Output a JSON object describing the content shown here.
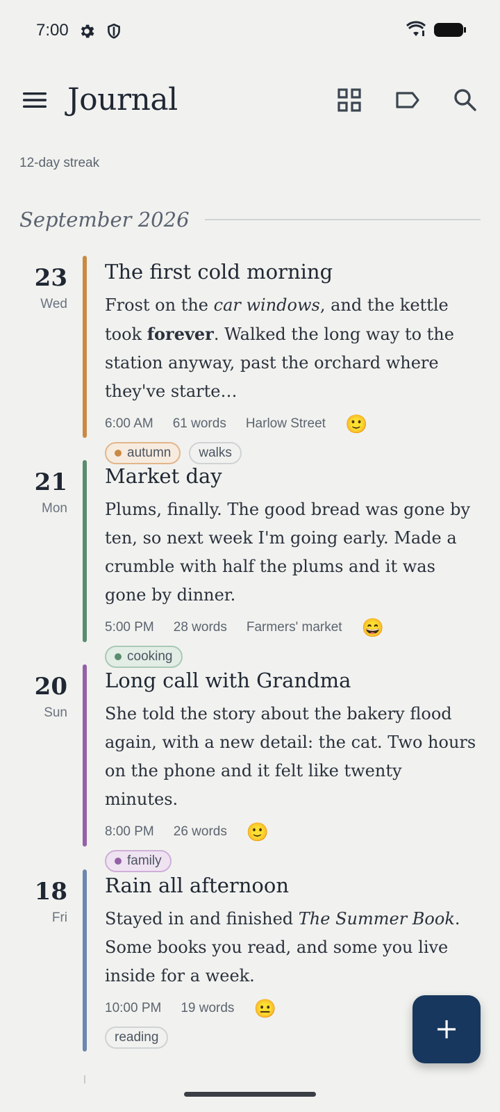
{
  "status_bar": {
    "time": "7:00",
    "icons": [
      "settings-icon",
      "shield-icon",
      "wifi-icon",
      "battery-icon"
    ]
  },
  "app_bar": {
    "title": "Journal",
    "actions": [
      "menu-icon",
      "grid-view-icon",
      "label-icon",
      "search-icon"
    ]
  },
  "streak": "12-day streak",
  "month": "September 2026",
  "entries": [
    {
      "day": "23",
      "weekday": "Wed",
      "title": "The first cold morning",
      "body": [
        "Frost on the ",
        "car windows",
        ", and the kettle took ",
        "forever",
        ". Walked the long way to the station anyway, past the orchard where they've starte…"
      ],
      "time": "6:00 AM",
      "words": "61 words",
      "location": "Harlow Street",
      "mood": "🙂",
      "accent": "#c98a45",
      "tags": [
        {
          "label": "autumn",
          "color": "#c98a45"
        },
        {
          "label": "walks",
          "color": ""
        }
      ]
    },
    {
      "day": "21",
      "weekday": "Mon",
      "title": "Market day",
      "body": "Plums, finally. The good bread was gone by ten, so next week I'm going early. Made a crumble with half the plums and it was gone by dinner.",
      "time": "5:00 PM",
      "words": "28 words",
      "location": "Farmers' market",
      "mood": "😄",
      "accent": "#5a8c6e",
      "tags": [
        {
          "label": "cooking",
          "color": "#5a8c6e"
        }
      ]
    },
    {
      "day": "20",
      "weekday": "Sun",
      "title": "Long call with Grandma",
      "body": "She told the story about the bakery flood again, with a new detail: the cat. Two hours on the phone and it felt like twenty minutes.",
      "time": "8:00 PM",
      "words": "26 words",
      "mood": "🙂",
      "accent": "#9561a6",
      "tags": [
        {
          "label": "family",
          "color": "#9561a6"
        }
      ]
    },
    {
      "day": "18",
      "weekday": "Fri",
      "title": "Rain all afternoon",
      "body": [
        "Stayed in and finished ",
        "The Summer Book",
        ". Some books you read, and some you live inside for a week."
      ],
      "time": "10:00 PM",
      "words": "19 words",
      "mood": "😐",
      "accent": "#6e86b0",
      "tags": [
        {
          "label": "reading",
          "color": ""
        }
      ]
    }
  ],
  "fab": {
    "icon": "plus-icon",
    "label": "+"
  },
  "colors": {
    "background": "#f1f2ef",
    "text": "#1f2733",
    "fab": "#17375e"
  }
}
